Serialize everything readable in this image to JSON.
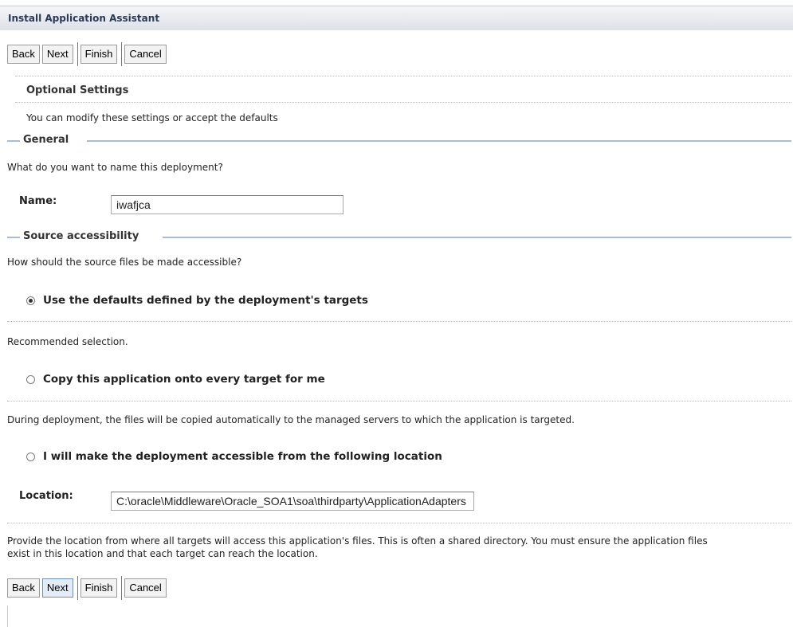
{
  "title": "Install Application Assistant",
  "buttons": {
    "back": "Back",
    "next": "Next",
    "finish": "Finish",
    "cancel": "Cancel"
  },
  "optional": {
    "heading": "Optional Settings",
    "subtitle": "You can modify these settings or accept the defaults"
  },
  "general": {
    "legend": "General",
    "question": "What do you want to name this deployment?",
    "name_label": "Name:",
    "name_value": "iwafjca"
  },
  "source": {
    "legend": "Source accessibility",
    "question": "How should the source files be made accessible?",
    "option1": "Use the defaults defined by the deployment's targets",
    "option1_desc": "Recommended selection.",
    "option2": "Copy this application onto every target for me",
    "option2_desc": "During deployment, the files will be copied automatically to the managed servers to which the application is targeted.",
    "option3": "I will make the deployment accessible from the following location",
    "location_label": "Location:",
    "location_value": "C:\\oracle\\Middleware\\Oracle_SOA1\\soa\\thirdparty\\ApplicationAdapters",
    "location_desc_1": "Provide the location from where all targets will access this application's files. This is often a shared directory. You must ensure the application files",
    "location_desc_2": "exist in this location and that each target can reach the location."
  }
}
